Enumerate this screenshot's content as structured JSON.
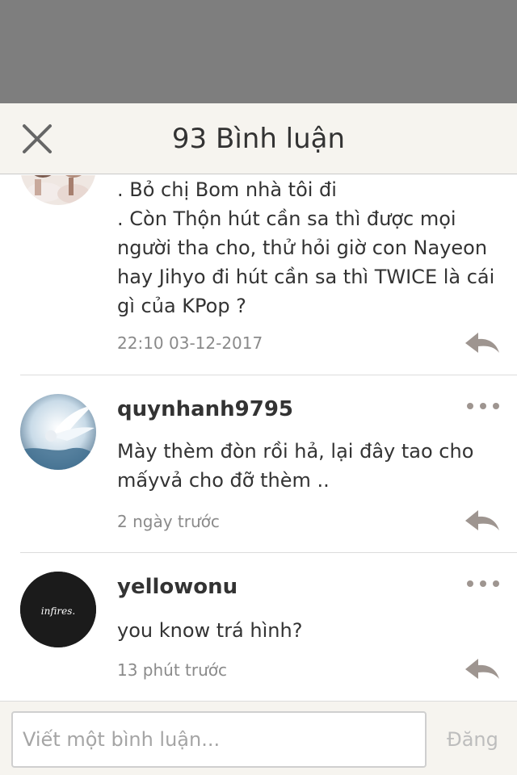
{
  "header": {
    "title": "93 Bình luận",
    "close_icon": "close-icon"
  },
  "comments": [
    {
      "username": "",
      "lines": [
        ". Bỏ chị Bom nhà tôi đi",
        ". Còn Thộn hút cần sa thì được mọi người tha cho, thử hỏi giờ con Nayeon hay Jihyo đi hút cần sa thì TWICE là cái gì của KPop ?"
      ],
      "time": "22:10 03-12-2017",
      "reply_icon": "reply-arrow-icon"
    },
    {
      "username": "quynhanh9795",
      "lines": [
        "Mày thèm đòn rồi hả, lại đây tao cho mấyvả cho đỡ thèm .."
      ],
      "time": "2 ngày trước",
      "reply_icon": "reply-arrow-icon",
      "more_icon": "more-dots-icon"
    },
    {
      "username": "yellowonu",
      "avatar_text": "infires.",
      "lines": [
        "you know trá hình?"
      ],
      "time": "13 phút trước",
      "reply_icon": "reply-arrow-icon",
      "more_icon": "more-dots-icon"
    }
  ],
  "footer": {
    "input_placeholder": "Viết một bình luận...",
    "input_value": "",
    "post_label": "Đăng"
  },
  "colors": {
    "backdrop": "#7e7e7e",
    "header_bg": "#f6f4ef",
    "text": "#333333",
    "muted": "#8a8a8a",
    "icon": "#9e9590",
    "post_disabled": "#bdbdbd"
  }
}
